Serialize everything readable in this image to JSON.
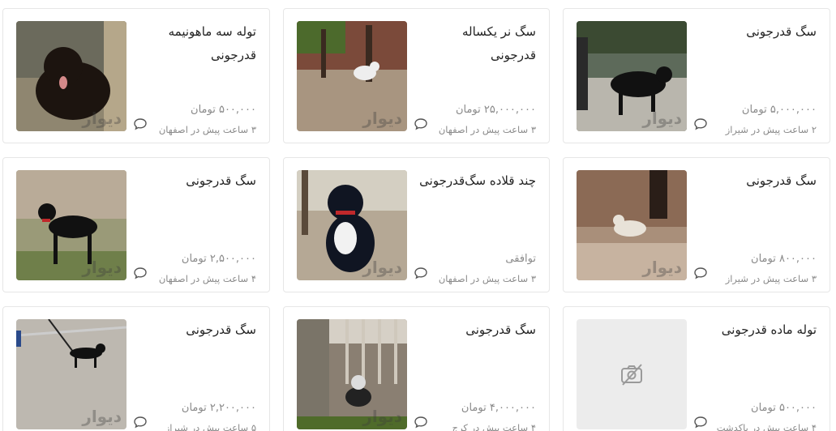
{
  "brand_watermark": "دیوار",
  "listings": [
    {
      "title": "سگ قدرجونی",
      "price": "۵,۰۰۰,۰۰۰ تومان",
      "meta": "۲ ساعت پیش در شیراز",
      "image": "black-dog-night"
    },
    {
      "title": "سگ نر یکساله قدرجونی",
      "price": "۲۵,۰۰۰,۰۰۰ تومان",
      "meta": "۳ ساعت پیش در اصفهان",
      "image": "white-dog-under-tree"
    },
    {
      "title": "توله سه ماهونیمه قدرجونی",
      "price": "۵۰۰,۰۰۰ تومان",
      "meta": "۳ ساعت پیش در اصفهان",
      "image": "black-puppy"
    },
    {
      "title": "سگ قدرجونی",
      "price": "۸۰۰,۰۰۰ تومان",
      "meta": "۳ ساعت پیش در شیراز",
      "image": "dog-on-rubble"
    },
    {
      "title": "چند قلاده سگ‌قدرجونی",
      "price": "توافقی",
      "meta": "۳ ساعت پیش در اصفهان",
      "image": "black-white-dog-sitting"
    },
    {
      "title": "سگ قدرجونی",
      "price": "۲,۵۰۰,۰۰۰ تومان",
      "meta": "۴ ساعت پیش در اصفهان",
      "image": "black-dog-red-collar"
    },
    {
      "title": "توله ماده قدرجونی",
      "price": "۵۰۰,۰۰۰ تومان",
      "meta": "۴ ساعت پیش در پاکدشت",
      "image": "no-image"
    },
    {
      "title": "سگ قدرجونی",
      "price": "۴,۰۰۰,۰۰۰ تومان",
      "meta": "۴ ساعت پیش در کرج",
      "image": "dog-under-stairs"
    },
    {
      "title": "سگ قدرجونی",
      "price": "۲,۲۰۰,۰۰۰ تومان",
      "meta": "۵ ساعت پیش در شیراز",
      "image": "dog-on-leash-road"
    }
  ],
  "icons": {
    "chat": "chat-bubble-icon",
    "no_image": "no-image-icon"
  },
  "colors": {
    "title": "#222222",
    "secondary": "#8a8a8a",
    "border": "#e6e6e6"
  }
}
